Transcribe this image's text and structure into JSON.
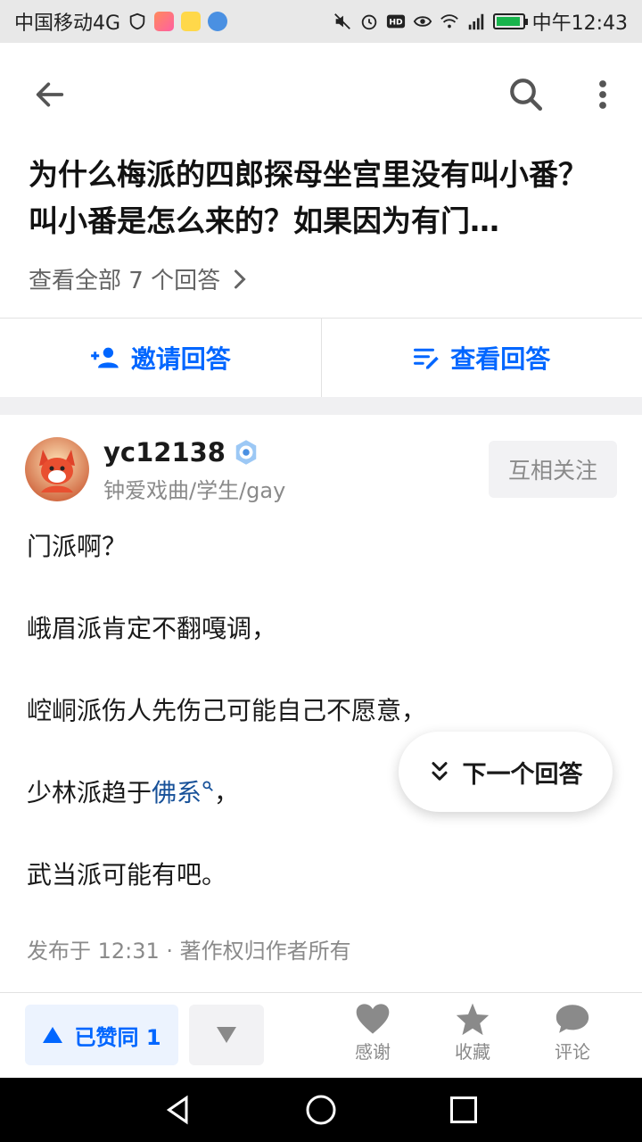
{
  "status_bar": {
    "carrier": "中国移动4G",
    "network": "4G",
    "time": "中午12:43",
    "colors": {
      "battery": "#18b44c"
    }
  },
  "header": {
    "back_icon": "arrow-left-icon",
    "search_icon": "search-icon",
    "more_icon": "more-vertical-icon"
  },
  "question": {
    "title": "为什么梅派的四郎探母坐宫里没有叫小番？叫小番是怎么来的？如果因为有门…",
    "view_all": "查看全部 7 个回答"
  },
  "actions": {
    "invite_label": "邀请回答",
    "view_label": "查看回答"
  },
  "author": {
    "name": "yc12138",
    "bio": "钟爱戏曲/学生/gay",
    "follow_label": "互相关注"
  },
  "answer": {
    "lines": [
      "门派啊？",
      "峨眉派肯定不翻嘎调，",
      "崆峒派伤人先伤己可能自己不愿意，",
      "少林派趋于",
      "武当派可能有吧。"
    ],
    "link_text": "佛系",
    "line4_suffix": "，",
    "meta": "发布于 12:31 · 著作权归作者所有"
  },
  "floating": {
    "next_label": "下一个回答"
  },
  "bottom_bar": {
    "upvote_label": "已赞同 1",
    "thanks_label": "感谢",
    "collect_label": "收藏",
    "comment_label": "评论",
    "colors": {
      "accent": "#0066ff",
      "muted": "#8a8a8a"
    }
  }
}
